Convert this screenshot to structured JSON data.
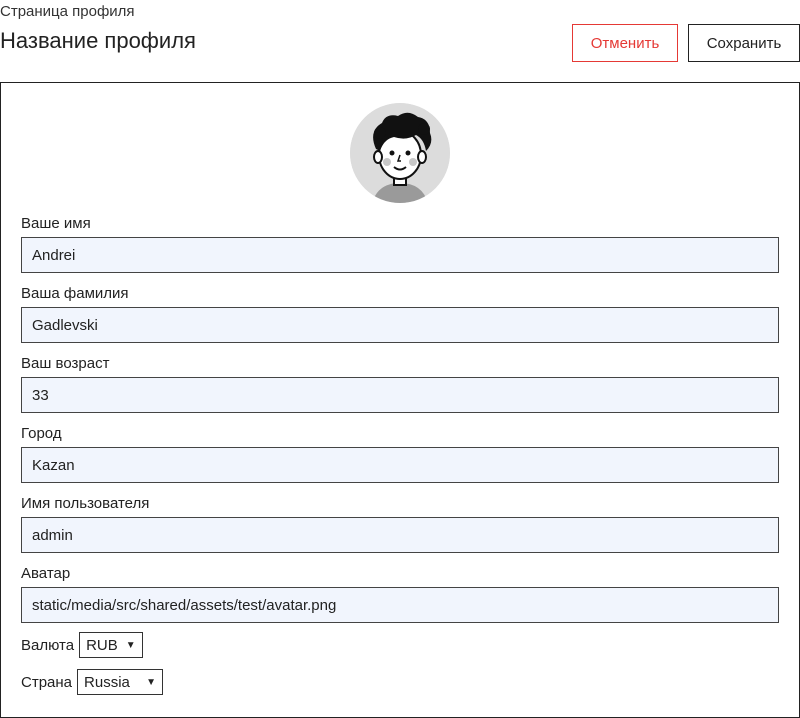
{
  "header": {
    "caption": "Страница профиля",
    "title": "Название профиля",
    "cancel_label": "Отменить",
    "save_label": "Сохранить"
  },
  "profile": {
    "avatar_icon": "avatar-illustration",
    "fields": {
      "first_name": {
        "label": "Ваше имя",
        "value": "Andrei"
      },
      "last_name": {
        "label": "Ваша фамилия",
        "value": "Gadlevski"
      },
      "age": {
        "label": "Ваш возраст",
        "value": "33"
      },
      "city": {
        "label": "Город",
        "value": "Kazan"
      },
      "username": {
        "label": "Имя пользователя",
        "value": "admin"
      },
      "avatar": {
        "label": "Аватар",
        "value": "static/media/src/shared/assets/test/avatar.png"
      }
    },
    "currency": {
      "label": "Валюта",
      "value": "RUB"
    },
    "country": {
      "label": "Страна",
      "value": "Russia"
    }
  },
  "colors": {
    "cancel": "#e53935",
    "input_bg": "#f1f5fd",
    "border": "#222222"
  }
}
